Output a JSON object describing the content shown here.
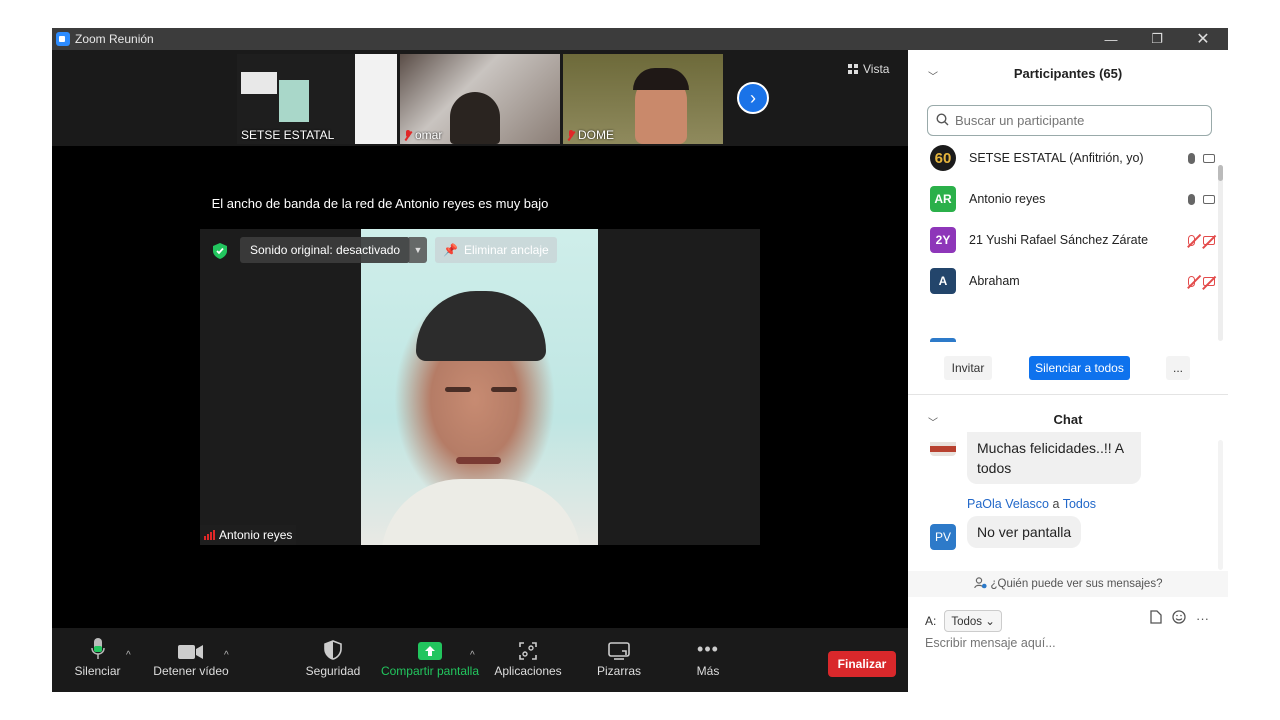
{
  "window": {
    "title": "Zoom Reunión"
  },
  "strip": {
    "thumbs": [
      {
        "name": "SETSE ESTATAL",
        "muted": false
      },
      {
        "name": "omar",
        "muted": true
      },
      {
        "name": "DOME",
        "muted": true
      }
    ],
    "view_label": "Vista"
  },
  "main": {
    "bandwidth_message": "El ancho de banda de la red de Antonio reyes es muy bajo",
    "original_sound_label": "Sonido original: desactivado",
    "unpin_label": "Eliminar anclaje",
    "speaker_name": "Antonio reyes"
  },
  "toolbar": {
    "mute_label": "Silenciar",
    "video_label": "Detener vídeo",
    "security_label": "Seguridad",
    "share_label": "Compartir pantalla",
    "apps_label": "Aplicaciones",
    "whiteboards_label": "Pizarras",
    "more_label": "Más",
    "end_label": "Finalizar"
  },
  "participants": {
    "title": "Participantes (65)",
    "search_placeholder": "Buscar un participante",
    "list": [
      {
        "initials": "60",
        "name": "SETSE ESTATAL (Anfitrión, yo)",
        "color": "#1b1b1b",
        "muted": false
      },
      {
        "initials": "AR",
        "name": "Antonio reyes",
        "color": "#2bb04a",
        "muted": false
      },
      {
        "initials": "2Y",
        "name": "21 Yushi Rafael Sánchez Zárate",
        "color": "#8e36b9",
        "muted": true
      },
      {
        "initials": "A",
        "name": "Abraham",
        "color": "#23456b",
        "muted": true
      }
    ],
    "invite_label": "Invitar",
    "mute_all_label": "Silenciar a todos",
    "more_label": "..."
  },
  "chat": {
    "title": "Chat",
    "messages": [
      {
        "text": "Muchas felicidades..!! A todos"
      },
      {
        "sender": "PaOla Velasco",
        "connector": "a",
        "recipient": "Todos",
        "initials": "PV",
        "text": "No ver pantalla"
      }
    ],
    "who_can_see": "¿Quién puede ver sus mensajes?",
    "to_label": "A:",
    "to_value": "Todos",
    "input_placeholder": "Escribir mensaje aquí..."
  },
  "colors": {
    "accent": "#0e72ed",
    "end": "#d9282b",
    "share": "#22c55e"
  }
}
